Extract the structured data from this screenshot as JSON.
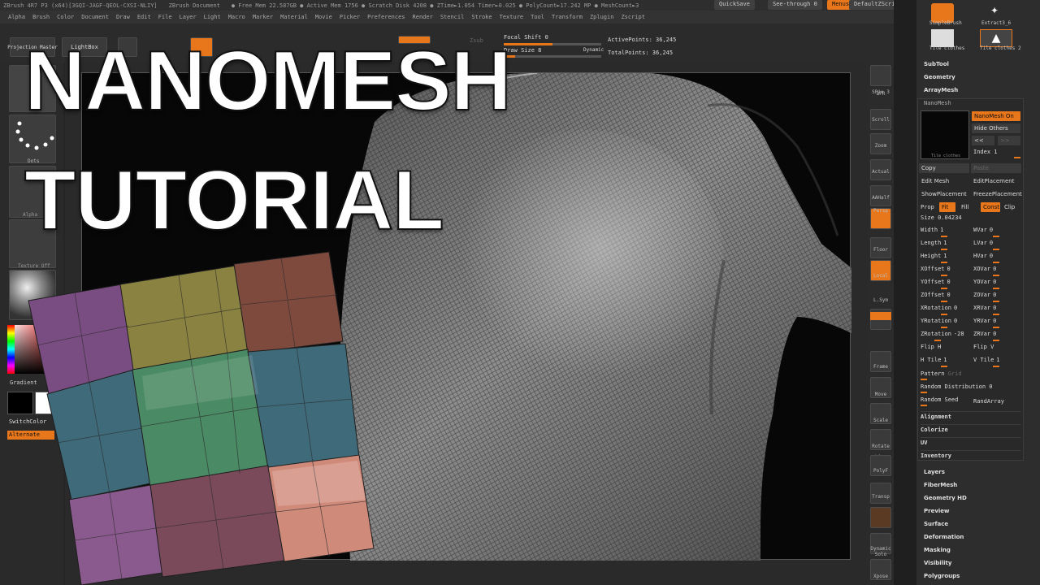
{
  "window": {
    "titlebar": [
      "ZBrush 4R7 P3 (x64)[3GQI-JAGF-QEOL-CXSI-NLIY]",
      "ZBrush Document",
      "● Free Mem 22.587GB ● Active Mem 1756 ● Scratch Disk 4208 ● ZTime►1.054 Timer►0.025 ● PolyCount►17.242 MP ● MeshCount►3"
    ],
    "menus": [
      "Alpha",
      "Brush",
      "Color",
      "Document",
      "Draw",
      "Edit",
      "File",
      "Layer",
      "Light",
      "Macro",
      "Marker",
      "Material",
      "Movie",
      "Picker",
      "Preferences",
      "Render",
      "Stencil",
      "Stroke",
      "Texture",
      "Tool",
      "Transform",
      "Zplugin",
      "Zscript"
    ],
    "quicksave": "QuickSave",
    "seethrough_label": "See-through",
    "seethrough_value": "0",
    "menus_btn": "Menus",
    "default_script": "DefaultZScript"
  },
  "topshelf": {
    "projection_master": "Projection Master",
    "lightbox": "LightBox",
    "zsub": "Zsub",
    "focal_shift_label": "Focal Shift",
    "focal_shift_value": "0",
    "draw_size_label": "Draw Size",
    "draw_size_value": "8",
    "dynamic": "Dynamic",
    "active_points_label": "ActivePoints:",
    "active_points_value": "36,245",
    "total_points_label": "TotalPoints:",
    "total_points_value": "36,245"
  },
  "leftshelf": {
    "dots": "Dots",
    "alpha": "Alpha",
    "texture": "Texture Off",
    "gradient": "Gradient",
    "switchcolor": "SwitchColor",
    "alternate": "Alternate"
  },
  "overlay": {
    "line1": "NANOMESH",
    "line2": "TUTORIAL"
  },
  "rightshelf": [
    "BPR",
    "SPix 3",
    "Scroll",
    "Zoom",
    "Actual",
    "AAHalf",
    "Persp",
    "Floor",
    "Local",
    "L.Sym",
    "Gxyz",
    "",
    "Frame",
    "Move",
    "Scale",
    "Rotate",
    "Line Fill",
    "PolyF",
    "Transp",
    "Ghost",
    "Dynamic Solo",
    "Xpose"
  ],
  "rightpanel": {
    "top_items": [
      "SimpleBrush",
      "Extract3_6",
      "Tile clothes",
      "Tile clothes 2"
    ],
    "subtool": "SubTool",
    "geometry": "Geometry",
    "arraymesh": "ArrayMesh",
    "nanomesh": "NanoMesh",
    "nanomesh_on": "NanoMesh On",
    "hide_others": "Hide Others",
    "prev": "<<",
    "next": ">>",
    "index_label": "Index",
    "index_value": "1",
    "thumb_label": "Tile clothes",
    "copy": "Copy",
    "paste": "Paste",
    "edit_mesh": "Edit Mesh",
    "edit_placement": "EditPlacement",
    "show_placement": "ShowPlacement",
    "freeze_placement": "FreezePlacement",
    "prop_label": "Prop",
    "fit": "Fit",
    "fill": "Fill",
    "const": "Const",
    "clip": "Clip",
    "size_label": "Size",
    "size_value": "0.04234",
    "sliders_left": [
      [
        "Width",
        "1"
      ],
      [
        "Length",
        "1"
      ],
      [
        "Height",
        "1"
      ],
      [
        "XOffset",
        "0"
      ],
      [
        "YOffset",
        "0"
      ],
      [
        "ZOffset",
        "0"
      ],
      [
        "XRotation",
        "0"
      ],
      [
        "YRotation",
        "0"
      ],
      [
        "ZRotation",
        "-28"
      ],
      [
        "Flip H",
        ""
      ],
      [
        "H Tile",
        "1"
      ]
    ],
    "sliders_right": [
      [
        "WVar",
        "0"
      ],
      [
        "LVar",
        "0"
      ],
      [
        "HVar",
        "0"
      ],
      [
        "XOVar",
        "0"
      ],
      [
        "YOVar",
        "0"
      ],
      [
        "ZOVar",
        "0"
      ],
      [
        "XRVar",
        "0"
      ],
      [
        "YRVar",
        "0"
      ],
      [
        "ZRVar",
        "0"
      ],
      [
        "Flip V",
        ""
      ],
      [
        "V Tile",
        "1"
      ]
    ],
    "pattern": "Pattern",
    "pattern_value": "Grid",
    "random_distribution": "Random Distribution",
    "random_distribution_value": "0",
    "random_seed": "Random Seed",
    "randarray": "RandArray",
    "sections_mid": [
      "Alignment",
      "Colorize",
      "UV",
      "Inventory"
    ],
    "sections_bottom": [
      "Layers",
      "FiberMesh",
      "Geometry HD",
      "Preview",
      "Surface",
      "Deformation",
      "Masking",
      "Visibility",
      "Polygroups"
    ]
  },
  "colors": {
    "orange": "#e8761a",
    "panel_bg": "#2d2d2d",
    "canvas_bg": "#070707"
  }
}
